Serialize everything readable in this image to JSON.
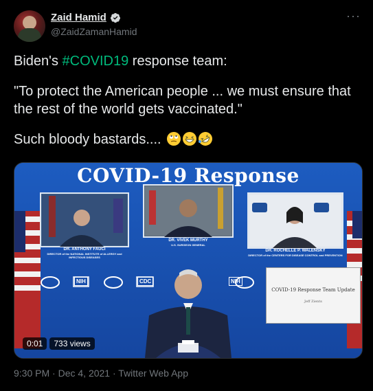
{
  "author": {
    "name": "Zaid Hamid",
    "handle": "@ZaidZamanHamid"
  },
  "tweet": {
    "line1_prefix": "Biden's ",
    "hashtag": "#COVID19",
    "line1_suffix": " response team:",
    "quote": "\"To protect the American people ... we must ensure that the rest of the world gets vaccinated.\"",
    "line3": "Such bloody bastards...."
  },
  "media": {
    "banner": "COVID-19 Response",
    "panel_left_name": "DR. ANTHONY FAUCI",
    "panel_left_title": "DIRECTOR of the NATIONAL INSTITUTE of ALLERGY and INFECTIOUS DISEASES",
    "panel_mid_name": "DR. VIVEK MURTHY",
    "panel_mid_title": "U.S. SURGEON GENERAL",
    "panel_right_name": "DR. ROCHELLE P. WALENSKY",
    "panel_right_title": "DIRECTOR of the CENTERS FOR DISEASE CONTROL and PREVENTION",
    "slide_title": "COVID-19 Response Team Update",
    "slide_sub": "Jeff Zients",
    "logo_nih": "NIH",
    "logo_cdc": "CDC",
    "time_elapsed": "0:01",
    "views": "733 views"
  },
  "footer": {
    "time": "9:30 PM",
    "date": "Dec 4, 2021",
    "source": "Twitter Web App",
    "sep": " · "
  },
  "colors": {
    "background": "#000000",
    "hashtag": "#00ba7c",
    "muted": "#71767b",
    "media_blue": "#1a57b8"
  }
}
